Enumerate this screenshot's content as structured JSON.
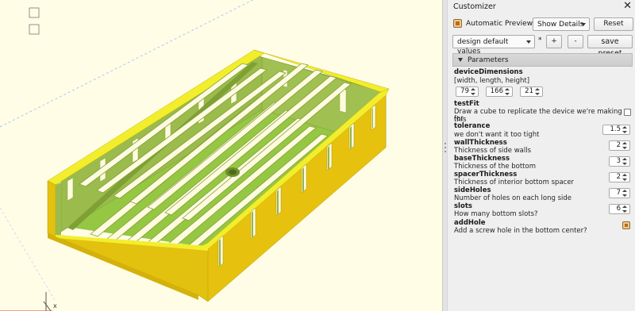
{
  "customizer": {
    "title": "Customizer",
    "automatic_preview_label": "Automatic Preview",
    "automatic_preview_checked": true,
    "details_select": "Show Details",
    "reset_label": "Reset",
    "preset_select": "design default values",
    "preset_marker": "*",
    "add_preset_label": "+",
    "remove_preset_label": "-",
    "save_preset_label": "save preset",
    "parameters_header": "Parameters"
  },
  "params": {
    "deviceDimensions": {
      "name": "deviceDimensions",
      "desc": "[width, length, height]",
      "values": [
        "79",
        "166",
        "21"
      ]
    },
    "testFit": {
      "name": "testFit",
      "desc_line1": "Draw a cube to replicate the device we're making this",
      "desc_line2": "for",
      "checked": false
    },
    "tolerance": {
      "name": "tolerance",
      "desc": "we don't want it too tight",
      "value": "1.5"
    },
    "wallThickness": {
      "name": "wallThickness",
      "desc": "Thickness of side walls",
      "value": "2"
    },
    "baseThickness": {
      "name": "baseThickness",
      "desc": "Thickness of the bottom",
      "value": "3"
    },
    "spacerThickness": {
      "name": "spacerThickness",
      "desc": "Thickness of interior bottom spacer",
      "value": "2"
    },
    "sideHoles": {
      "name": "sideHoles",
      "desc": "Number of holes on each long side",
      "value": "7"
    },
    "slots": {
      "name": "slots",
      "desc": "How many bottom slots?",
      "value": "6"
    },
    "addHole": {
      "name": "addHole",
      "desc": "Add a screw hole in the bottom center?",
      "checked": true
    }
  },
  "viewport": {
    "axis_label": "x",
    "colors": {
      "background": "#fffde6",
      "top_face": "#f2ed2a",
      "outer_wall": "#e3c10f",
      "inner_wall": "#97b64a",
      "floor": "#95c743",
      "slot": "#fffbe0"
    }
  }
}
